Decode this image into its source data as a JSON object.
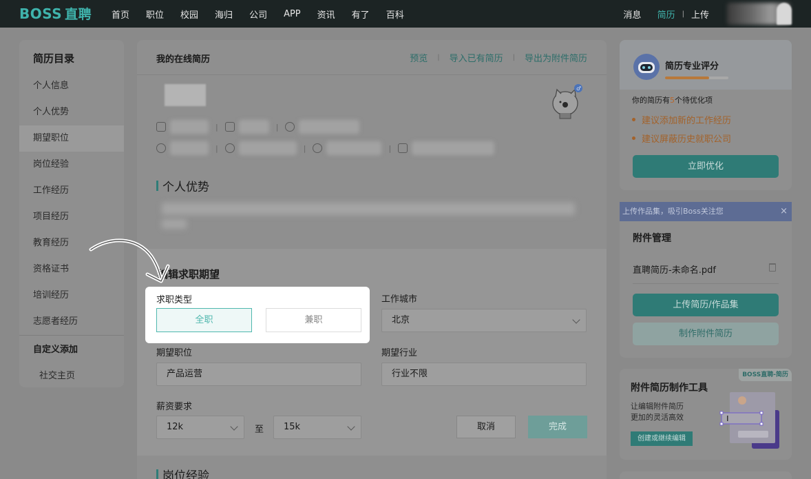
{
  "topbar": {
    "logo_latin": "BOSS",
    "logo_cn": "直聘",
    "nav": [
      "首页",
      "职位",
      "校园",
      "海归",
      "公司",
      "APP",
      "资讯",
      "有了",
      "百科"
    ],
    "messages": "消息",
    "resume": "简历",
    "upload": "上传"
  },
  "sidebar": {
    "title": "简历目录",
    "items": [
      "个人信息",
      "个人优势",
      "期望职位",
      "岗位经验",
      "工作经历",
      "项目经历",
      "教育经历",
      "资格证书",
      "培训经历",
      "志愿者经历"
    ],
    "active": "期望职位",
    "custom_title": "自定义添加",
    "social": "社交主页"
  },
  "resume": {
    "header_title": "我的在线简历",
    "links": [
      "预览",
      "导入已有简历",
      "导出为附件简历"
    ],
    "advantage_title": "个人优势",
    "job_exp_title": "岗位经验"
  },
  "expectation": {
    "title": "编辑求职期望",
    "type_label": "求职类型",
    "type_options": [
      "全职",
      "兼职"
    ],
    "type_selected": "全职",
    "city_label": "工作城市",
    "city_value": "北京",
    "position_label": "期望职位",
    "position_value": "产品运营",
    "industry_label": "期望行业",
    "industry_value": "行业不限",
    "salary_label": "薪资要求",
    "salary_min": "12k",
    "salary_to": "至",
    "salary_max": "15k",
    "cancel": "取消",
    "done": "完成"
  },
  "score_card": {
    "title": "简历专业评分",
    "progress": 0.7,
    "summary_prefix": "你的简历有",
    "summary_count": "5",
    "summary_suffix": "个待优化项",
    "tips": [
      "建议添加新的工作经历",
      "建议屏蔽历史就职公司"
    ],
    "optimize_button": "立即优化"
  },
  "banner": {
    "text": "上传作品集，吸引Boss关注您",
    "close": "×"
  },
  "attachments": {
    "title": "附件管理",
    "file": "直聘简历-未命名.pdf",
    "upload_button": "上传简历/作品集",
    "make_button": "制作附件简历"
  },
  "tool_card": {
    "badge": "BOSS直聘-简历",
    "title": "附件简历制作工具",
    "desc1": "让编辑附件简历",
    "desc2": "更加的灵活高效",
    "button": "创建或继续编辑"
  },
  "colors": {
    "brand": "#3fb3ac",
    "accent_orange": "#a3622a",
    "overlay_dim": "#8f8f8f"
  }
}
